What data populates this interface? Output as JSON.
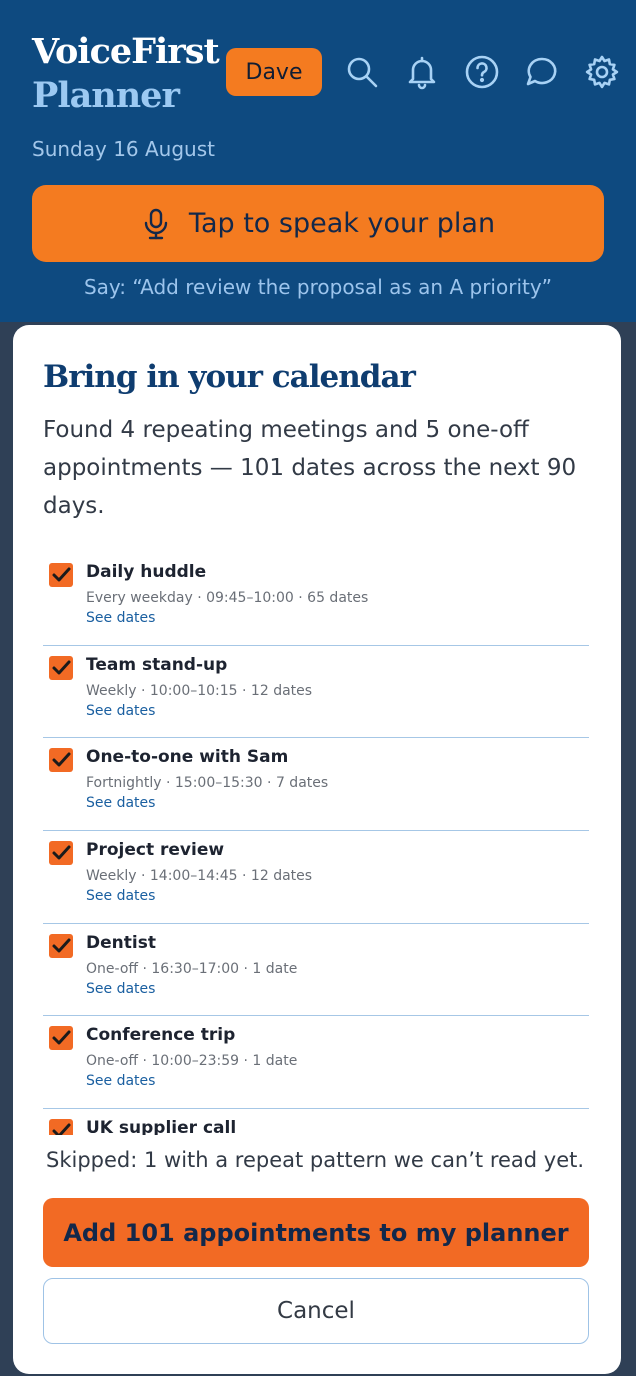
{
  "header": {
    "brand_line1": "VoiceFirst",
    "brand_line2": "Planner",
    "user_label": "Dave",
    "icons": [
      "search-icon",
      "bell-icon",
      "help-icon",
      "chat-icon",
      "gear-icon"
    ],
    "date": "Sunday 16 August"
  },
  "voice": {
    "button_label": "Tap to speak your plan",
    "hint": "Say: “Add review the proposal as an A priority”"
  },
  "modal": {
    "title": "Bring in your calendar",
    "description": "Found 4 repeating meetings and 5 one-off appointments — 101 dates across the next 90 days.",
    "items": [
      {
        "name": "Daily huddle",
        "meta": "Every weekday · 09:45–10:00 · 65 dates",
        "link": "See dates",
        "checked": true
      },
      {
        "name": "Team stand-up",
        "meta": "Weekly · 10:00–10:15 · 12 dates",
        "link": "See dates",
        "checked": true
      },
      {
        "name": "One-to-one with Sam",
        "meta": "Fortnightly · 15:00–15:30 · 7 dates",
        "link": "See dates",
        "checked": true
      },
      {
        "name": "Project review",
        "meta": "Weekly · 14:00–14:45 · 12 dates",
        "link": "See dates",
        "checked": true
      },
      {
        "name": "Dentist",
        "meta": "One-off · 16:30–17:00 · 1 date",
        "link": "See dates",
        "checked": true
      },
      {
        "name": "Conference trip",
        "meta": "One-off · 10:00–23:59 · 1 date",
        "link": "See dates",
        "checked": true
      },
      {
        "name": "UK supplier call",
        "meta": "",
        "link": "",
        "checked": true
      }
    ],
    "skipped": "Skipped: 1 with a repeat pattern we can’t read yet.",
    "add_label": "Add 101 appointments to my planner",
    "cancel_label": "Cancel"
  },
  "colors": {
    "background": "#0e4a80",
    "accent": "#f47b20",
    "checkbox": "#f26a24",
    "link": "#1a5fa0"
  }
}
